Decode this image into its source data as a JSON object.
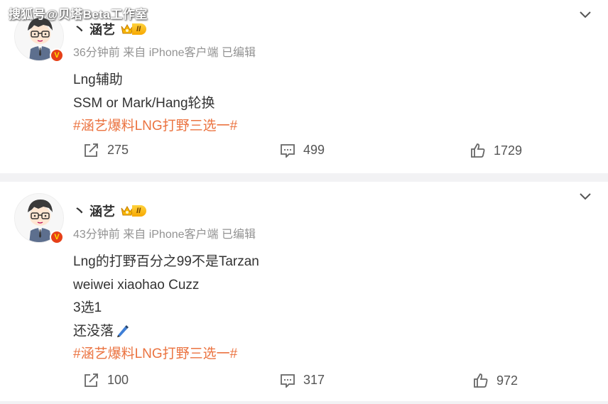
{
  "watermark": "搜狐号@贝塔Beta工作室",
  "posts": [
    {
      "author": "丶 涵艺",
      "level": "II",
      "meta": "36分钟前 来自 iPhone客户端 已编辑",
      "lines": [
        "Lng辅助",
        "SSM or  Mark/Hang轮换"
      ],
      "hashtag": "#涵艺爆料LNG打野三选一#",
      "repost_count": "275",
      "comment_count": "499",
      "like_count": "1729"
    },
    {
      "author": "丶 涵艺",
      "level": "II",
      "meta": "43分钟前 来自 iPhone客户端 已编辑",
      "lines": [
        "Lng的打野百分之99不是Tarzan",
        "weiwei xiaohao Cuzz",
        "3选1",
        "还没落"
      ],
      "emoji": "pen-emoji",
      "hashtag": "#涵艺爆料LNG打野三选一#",
      "repost_count": "100",
      "comment_count": "317",
      "like_count": "972"
    }
  ],
  "colors": {
    "hashtag": "#eb7340",
    "meta": "#939393",
    "divider": "#f2f2f4",
    "verified_badge": "#e64018"
  }
}
